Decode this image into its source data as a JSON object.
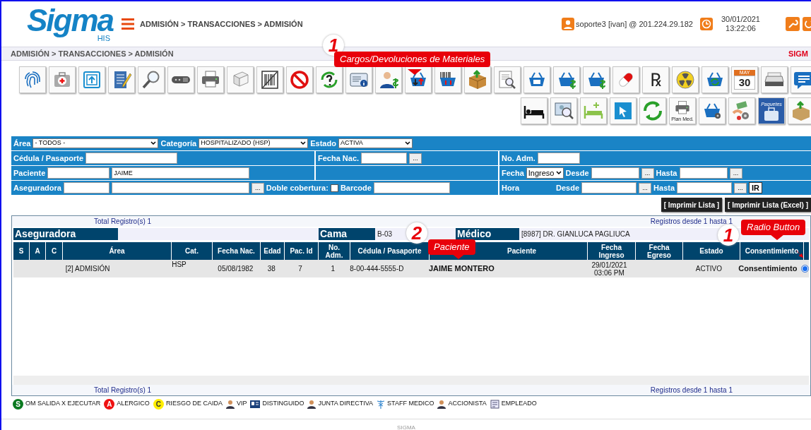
{
  "header": {
    "logo": "Sigma",
    "logo_sub": "HIS",
    "breadcrumb": "ADMISIÓN > TRANSACCIONES > ADMISIÓN",
    "user": "soporte3 [ivan] @ 201.224.29.182",
    "date": "30/01/2021",
    "time": "13:22:06"
  },
  "sub_bar": {
    "breadcrumb": "ADMISIÓN > TRANSACCIONES > ADMISIÓN",
    "brand": "SIGM"
  },
  "toolbar": {
    "rows": [
      [
        {
          "kind": "fingerprint"
        },
        {
          "kind": "medkit"
        },
        {
          "kind": "upload"
        },
        {
          "kind": "notepad"
        },
        {
          "kind": "magnifier"
        },
        {
          "kind": "bracelet"
        },
        {
          "kind": "printer"
        },
        {
          "kind": "labels"
        },
        {
          "kind": "barcode"
        },
        {
          "kind": "prohibited"
        },
        {
          "kind": "question"
        },
        {
          "kind": "infocard"
        },
        {
          "kind": "personmoney"
        },
        {
          "kind": "basket"
        },
        {
          "kind": "basketbarcode"
        },
        {
          "kind": "box"
        },
        {
          "kind": "docsearch"
        },
        {
          "kind": "basketprint"
        },
        {
          "kind": "basketmoney"
        },
        {
          "kind": "basketmoney"
        },
        {
          "kind": "pill"
        },
        {
          "kind": "rx",
          "label": "℞"
        },
        {
          "kind": "radiation"
        },
        {
          "kind": "basketrefresh"
        },
        {
          "kind": "calendar",
          "month": "MAY",
          "day": "30"
        },
        {
          "kind": "scanner"
        },
        {
          "kind": "chat"
        }
      ],
      [
        {
          "kind": "bed"
        },
        {
          "kind": "monitor"
        },
        {
          "kind": "bedplus"
        },
        {
          "kind": "arrowsquare"
        },
        {
          "kind": "refresh"
        },
        {
          "kind": "printer",
          "label": "Plan Med."
        },
        {
          "kind": "basketgear"
        },
        {
          "kind": "handsgear"
        },
        {
          "kind": "suitcase",
          "label": "Paquetes"
        },
        {
          "kind": "boxmoney"
        }
      ]
    ]
  },
  "filters": [
    {
      "groups": [
        {
          "kind": "wide",
          "items": [
            {
              "kind": "label",
              "text": "Área"
            },
            {
              "kind": "select",
              "value": "- TODOS -"
            },
            {
              "kind": "label",
              "text": "Categoría"
            },
            {
              "kind": "select",
              "value": "HOSPITALIZADO (HSP)"
            },
            {
              "kind": "label",
              "text": "Estado"
            },
            {
              "kind": "select",
              "value": "ACTIVA"
            }
          ]
        }
      ]
    },
    {
      "groups": [
        {
          "kind": "left",
          "items": [
            {
              "kind": "label",
              "text": "Cédula / Pasaporte"
            },
            {
              "kind": "input"
            }
          ]
        },
        {
          "kind": "middle",
          "items": [
            {
              "kind": "label",
              "text": "Fecha Nac."
            },
            {
              "kind": "input"
            },
            {
              "kind": "button",
              "text": "..."
            }
          ]
        },
        {
          "kind": "right",
          "items": [
            {
              "kind": "label",
              "text": "No. Adm."
            },
            {
              "kind": "input"
            }
          ]
        }
      ]
    },
    {
      "groups": [
        {
          "kind": "left",
          "items": [
            {
              "kind": "label",
              "text": "Paciente"
            },
            {
              "kind": "input"
            },
            {
              "kind": "input",
              "value": "JAIME"
            }
          ]
        },
        {
          "kind": "middle"
        },
        {
          "kind": "right",
          "items": [
            {
              "kind": "label",
              "text": "Fecha"
            },
            {
              "kind": "dropdown",
              "value": "Ingreso"
            },
            {
              "kind": "label",
              "text": "Desde"
            },
            {
              "kind": "input"
            },
            {
              "kind": "button",
              "text": "..."
            },
            {
              "kind": "label",
              "text": "Hasta"
            },
            {
              "kind": "input"
            },
            {
              "kind": "button",
              "text": "..."
            }
          ]
        }
      ]
    },
    {
      "groups": [
        {
          "kind": "wide",
          "items": [
            {
              "kind": "label",
              "text": "Aseguradora"
            },
            {
              "kind": "input"
            },
            {
              "kind": "input"
            },
            {
              "kind": "button",
              "text": "..."
            },
            {
              "kind": "label",
              "text": "Doble cobertura:"
            },
            {
              "kind": "checkbox",
              "checked": false
            },
            {
              "kind": "label",
              "text": "Barcode"
            },
            {
              "kind": "input"
            }
          ]
        },
        {
          "kind": "right",
          "items": [
            {
              "kind": "label",
              "text": "Hora"
            },
            {
              "kind": "spacer"
            },
            {
              "kind": "label",
              "text": "Desde"
            },
            {
              "kind": "input"
            },
            {
              "kind": "button",
              "text": "..."
            },
            {
              "kind": "label",
              "text": "Hasta"
            },
            {
              "kind": "input"
            },
            {
              "kind": "button",
              "text": "..."
            },
            {
              "kind": "go",
              "text": "IR"
            }
          ]
        }
      ]
    }
  ],
  "print_buttons": [
    "[ Imprimir Lista ]",
    "[ Imprimir Lista (Excel) ]"
  ],
  "results": {
    "total_top": "Total Registro(s) 1",
    "range_top": "Registros desde 1 hasta 1",
    "info": [
      {
        "label": "Aseguradora"
      },
      {
        "label": "Cama",
        "value": "B-03"
      },
      {
        "label": "Médico",
        "value": "[8987] DR. GIANLUCA PAGLIUCA"
      }
    ],
    "columns": [
      "S",
      "A",
      "C",
      "Área",
      "Cat.",
      "Fecha Nac.",
      "Edad",
      "Pac. Id",
      "No. Adm.",
      "Cédula / Pasaporte",
      "Paciente",
      "Fecha Ingreso",
      "Fecha Egreso",
      "Estado",
      "Consentimiento",
      ""
    ],
    "rows": [
      {
        "cells": [
          "",
          "",
          "",
          "[2] ADMISIÓN",
          "HSP",
          "05/08/1982",
          "38",
          "7",
          "1",
          "8-00-444-5555-D",
          "JAIME MONTERO",
          "29/01/2021 03:06 PM",
          "",
          "ACTIVO",
          "Consentimiento"
        ],
        "selected": true
      }
    ],
    "total_bottom": "Total Registro(s) 1",
    "range_bottom": "Registros desde 1 hasta 1"
  },
  "legend": [
    {
      "kind": "letter",
      "letter": "S",
      "color": "#0b7a20",
      "text": "OM SALIDA X EJECUTAR"
    },
    {
      "kind": "letter",
      "letter": "A",
      "color": "#ee1111",
      "text": "ALERGICO"
    },
    {
      "kind": "letter",
      "letter": "C",
      "color": "#ffee00",
      "text": "RIESGO DE CAIDA"
    },
    {
      "kind": "person",
      "text": "VIP"
    },
    {
      "kind": "card",
      "text": "DISTINGUIDO"
    },
    {
      "kind": "person",
      "text": "JUNTA DIRECTIVA"
    },
    {
      "kind": "caduceus",
      "text": "STAFF MEDICO"
    },
    {
      "kind": "person",
      "text": "ACCIONISTA"
    },
    {
      "kind": "doc",
      "text": "EMPLEADO"
    }
  ],
  "footer": "SIGMA",
  "annotations": [
    {
      "kind": "toolbar",
      "number": "1",
      "text": "Cargos/Devoluciones de Materiales"
    },
    {
      "kind": "patient",
      "number": "2",
      "text": "Paciente"
    },
    {
      "kind": "radio",
      "number": "1",
      "text": "Radio Button"
    }
  ]
}
